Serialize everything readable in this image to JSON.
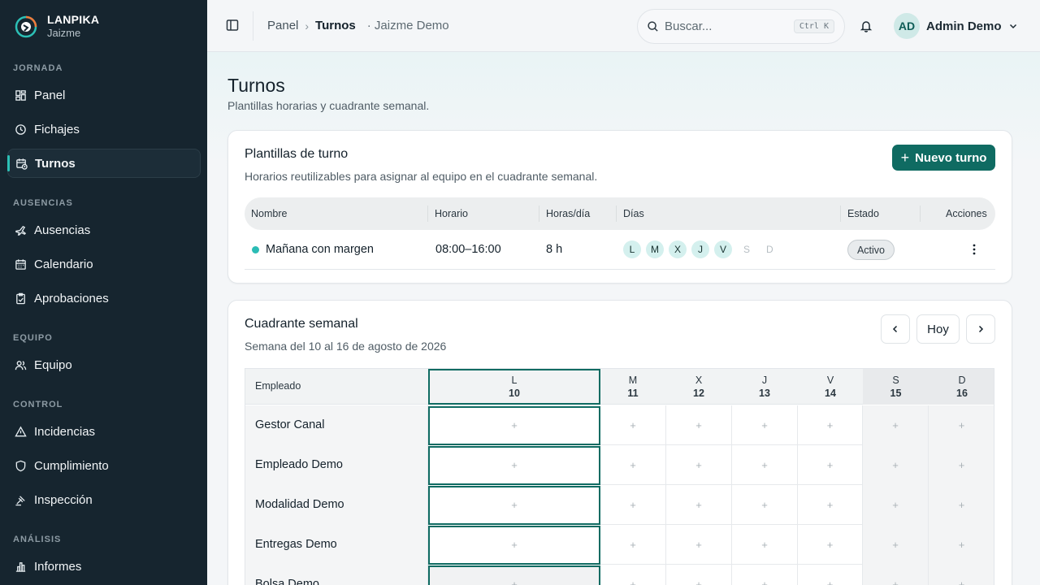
{
  "brand": {
    "name": "LANPIKA",
    "sub": "Jaizme"
  },
  "sidebar": {
    "sections": [
      {
        "title": "JORNADA",
        "items": [
          {
            "label": "Panel",
            "icon": "dashboard-icon"
          },
          {
            "label": "Fichajes",
            "icon": "clock-icon"
          },
          {
            "label": "Turnos",
            "icon": "calendar-clock-icon",
            "active": true
          }
        ]
      },
      {
        "title": "AUSENCIAS",
        "items": [
          {
            "label": "Ausencias",
            "icon": "plane-icon"
          },
          {
            "label": "Calendario",
            "icon": "calendar-icon"
          },
          {
            "label": "Aprobaciones",
            "icon": "clipboard-check-icon"
          }
        ]
      },
      {
        "title": "EQUIPO",
        "items": [
          {
            "label": "Equipo",
            "icon": "users-icon"
          }
        ]
      },
      {
        "title": "CONTROL",
        "items": [
          {
            "label": "Incidencias",
            "icon": "alert-triangle-icon"
          },
          {
            "label": "Cumplimiento",
            "icon": "shield-icon"
          },
          {
            "label": "Inspección",
            "icon": "scale-icon"
          }
        ]
      },
      {
        "title": "ANÁLISIS",
        "items": [
          {
            "label": "Informes",
            "icon": "bar-chart-icon"
          }
        ]
      }
    ]
  },
  "topbar": {
    "breadcrumb": [
      "Panel",
      "Turnos"
    ],
    "workspace": "· Jaizme Demo",
    "search_placeholder": "Buscar...",
    "search_shortcut": "Ctrl K",
    "user": {
      "initials": "AD",
      "name": "Admin Demo"
    }
  },
  "page": {
    "title": "Turnos",
    "subtitle": "Plantillas horarias y cuadrante semanal."
  },
  "templates": {
    "title": "Plantillas de turno",
    "subtitle": "Horarios reutilizables para asignar al equipo en el cuadrante semanal.",
    "new_button": "Nuevo turno",
    "columns": [
      "Nombre",
      "Horario",
      "Horas/día",
      "Días",
      "Estado",
      "Acciones"
    ],
    "rows": [
      {
        "name": "Mañana con margen",
        "color": "#2bbcb5",
        "schedule": "08:00–16:00",
        "hours": "8 h",
        "days": [
          {
            "d": "L",
            "on": true
          },
          {
            "d": "M",
            "on": true
          },
          {
            "d": "X",
            "on": true
          },
          {
            "d": "J",
            "on": true
          },
          {
            "d": "V",
            "on": true
          },
          {
            "d": "S",
            "on": false
          },
          {
            "d": "D",
            "on": false
          }
        ],
        "status": "Activo"
      }
    ]
  },
  "week": {
    "title": "Cuadrante semanal",
    "subtitle": "Semana del 10 al 16 de agosto de 2026",
    "today_button": "Hoy",
    "employee_header": "Empleado",
    "days": [
      {
        "d": "L",
        "n": "10"
      },
      {
        "d": "M",
        "n": "11"
      },
      {
        "d": "X",
        "n": "12"
      },
      {
        "d": "J",
        "n": "13"
      },
      {
        "d": "V",
        "n": "14"
      },
      {
        "d": "S",
        "n": "15"
      },
      {
        "d": "D",
        "n": "16"
      }
    ],
    "employees": [
      "Gestor Canal",
      "Empleado Demo",
      "Modalidad Demo",
      "Entregas Demo",
      "Bolsa Demo"
    ],
    "add_symbol": "+"
  },
  "colors": {
    "accent": "#0f6b62",
    "sidebar": "#16252f",
    "active_marker": "#2cc0b6"
  }
}
